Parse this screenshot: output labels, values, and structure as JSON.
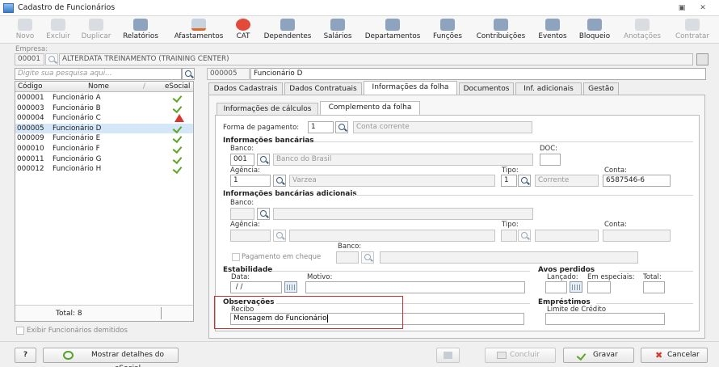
{
  "window": {
    "title": "Cadastro de Funcionários"
  },
  "toolbar": {
    "items": [
      {
        "label": "Novo",
        "icon": "new-icon"
      },
      {
        "label": "Excluir",
        "icon": "trash-icon"
      },
      {
        "label": "Duplicar",
        "icon": "users-icon"
      },
      {
        "label": "Relatórios",
        "icon": "report-icon"
      },
      {
        "label": "Afastamentos",
        "icon": "home-icon"
      },
      {
        "label": "CAT",
        "icon": "medical-cross-icon"
      },
      {
        "label": "Dependentes",
        "icon": "people-icon"
      },
      {
        "label": "Salários",
        "icon": "money-icon"
      },
      {
        "label": "Departamentos",
        "icon": "desk-icon"
      },
      {
        "label": "Funções",
        "icon": "clipboard-icon"
      },
      {
        "label": "Contribuições",
        "icon": "chat-icon"
      },
      {
        "label": "Eventos",
        "icon": "list-icon"
      },
      {
        "label": "Bloqueio",
        "icon": "lock-icon"
      },
      {
        "label": "Anotações",
        "icon": "note-icon"
      },
      {
        "label": "Contratar",
        "icon": "hire-icon"
      }
    ]
  },
  "empresa": {
    "label": "Empresa:",
    "code": "00001",
    "name": "ALTERDATA TREINAMENTO (TRAINING CENTER)"
  },
  "search": {
    "placeholder": "Digite sua pesquisa aqui..."
  },
  "employee": {
    "code": "000005",
    "name": "Funcionário D"
  },
  "grid": {
    "headers": {
      "code": "Código",
      "name": "Nome",
      "esocial": "eSocial"
    },
    "rows": [
      {
        "code": "000001",
        "name": "Funcionário A",
        "status": "ok"
      },
      {
        "code": "000003",
        "name": "Funcionário B",
        "status": "ok"
      },
      {
        "code": "000004",
        "name": "Funcionário C",
        "status": "warning"
      },
      {
        "code": "000005",
        "name": "Funcionário D",
        "status": "ok"
      },
      {
        "code": "000009",
        "name": "Funcionário E",
        "status": "ok"
      },
      {
        "code": "000010",
        "name": "Funcionário F",
        "status": "ok"
      },
      {
        "code": "000011",
        "name": "Funcionário G",
        "status": "ok"
      },
      {
        "code": "000012",
        "name": "Funcionário H",
        "status": "ok"
      }
    ],
    "total": "Total: 8"
  },
  "show_dismissed": "Exibir Funcionários demitidos",
  "tabs": [
    "Dados Cadastrais",
    "Dados Contratuais",
    "Informações da folha",
    "Documentos",
    "Inf. adicionais",
    "Gestão"
  ],
  "subtabs": [
    "Informações de cálculos",
    "Complemento da folha"
  ],
  "form": {
    "forma_pagamento": {
      "label": "Forma de pagamento:",
      "code": "1",
      "desc": "Conta corrente"
    },
    "banking": {
      "title": "Informações bancárias",
      "banco_label": "Banco:",
      "banco_code": "001",
      "banco_name": "Banco do Brasil",
      "doc_label": "DOC:",
      "agencia_label": "Agência:",
      "agencia_code": "1",
      "agencia_name": "Varzea",
      "tipo_label": "Tipo:",
      "tipo_code": "1",
      "tipo_name": "Corrente",
      "conta_label": "Conta:",
      "conta": "6587546-6"
    },
    "banking_extra": {
      "title": "Informações bancárias adicionais",
      "banco_label": "Banco:",
      "agencia_label": "Agência:",
      "tipo_label": "Tipo:",
      "conta_label": "Conta:",
      "banco2_label": "Banco:",
      "cheque_label": "Pagamento em cheque"
    },
    "estabilidade": {
      "title": "Estabilidade",
      "data_label": "Data:",
      "data_value": " / /",
      "motivo_label": "Motivo:"
    },
    "avos": {
      "title": "Avos perdidos",
      "lancado": "Lançado:",
      "especiais": "Em especiais:",
      "total": "Total:"
    },
    "observacoes": {
      "title": "Observações",
      "recibo_label": "Recibo",
      "recibo_value": "Mensagem do Funcionário"
    },
    "emprestimos": {
      "title": "Empréstimos",
      "limite_label": "Limite de Crédito"
    }
  },
  "footer": {
    "help": "?",
    "esocial_details": "Mostrar detalhes do eSocial",
    "concluir": "Concluir",
    "gravar": "Gravar",
    "cancelar": "Cancelar"
  }
}
